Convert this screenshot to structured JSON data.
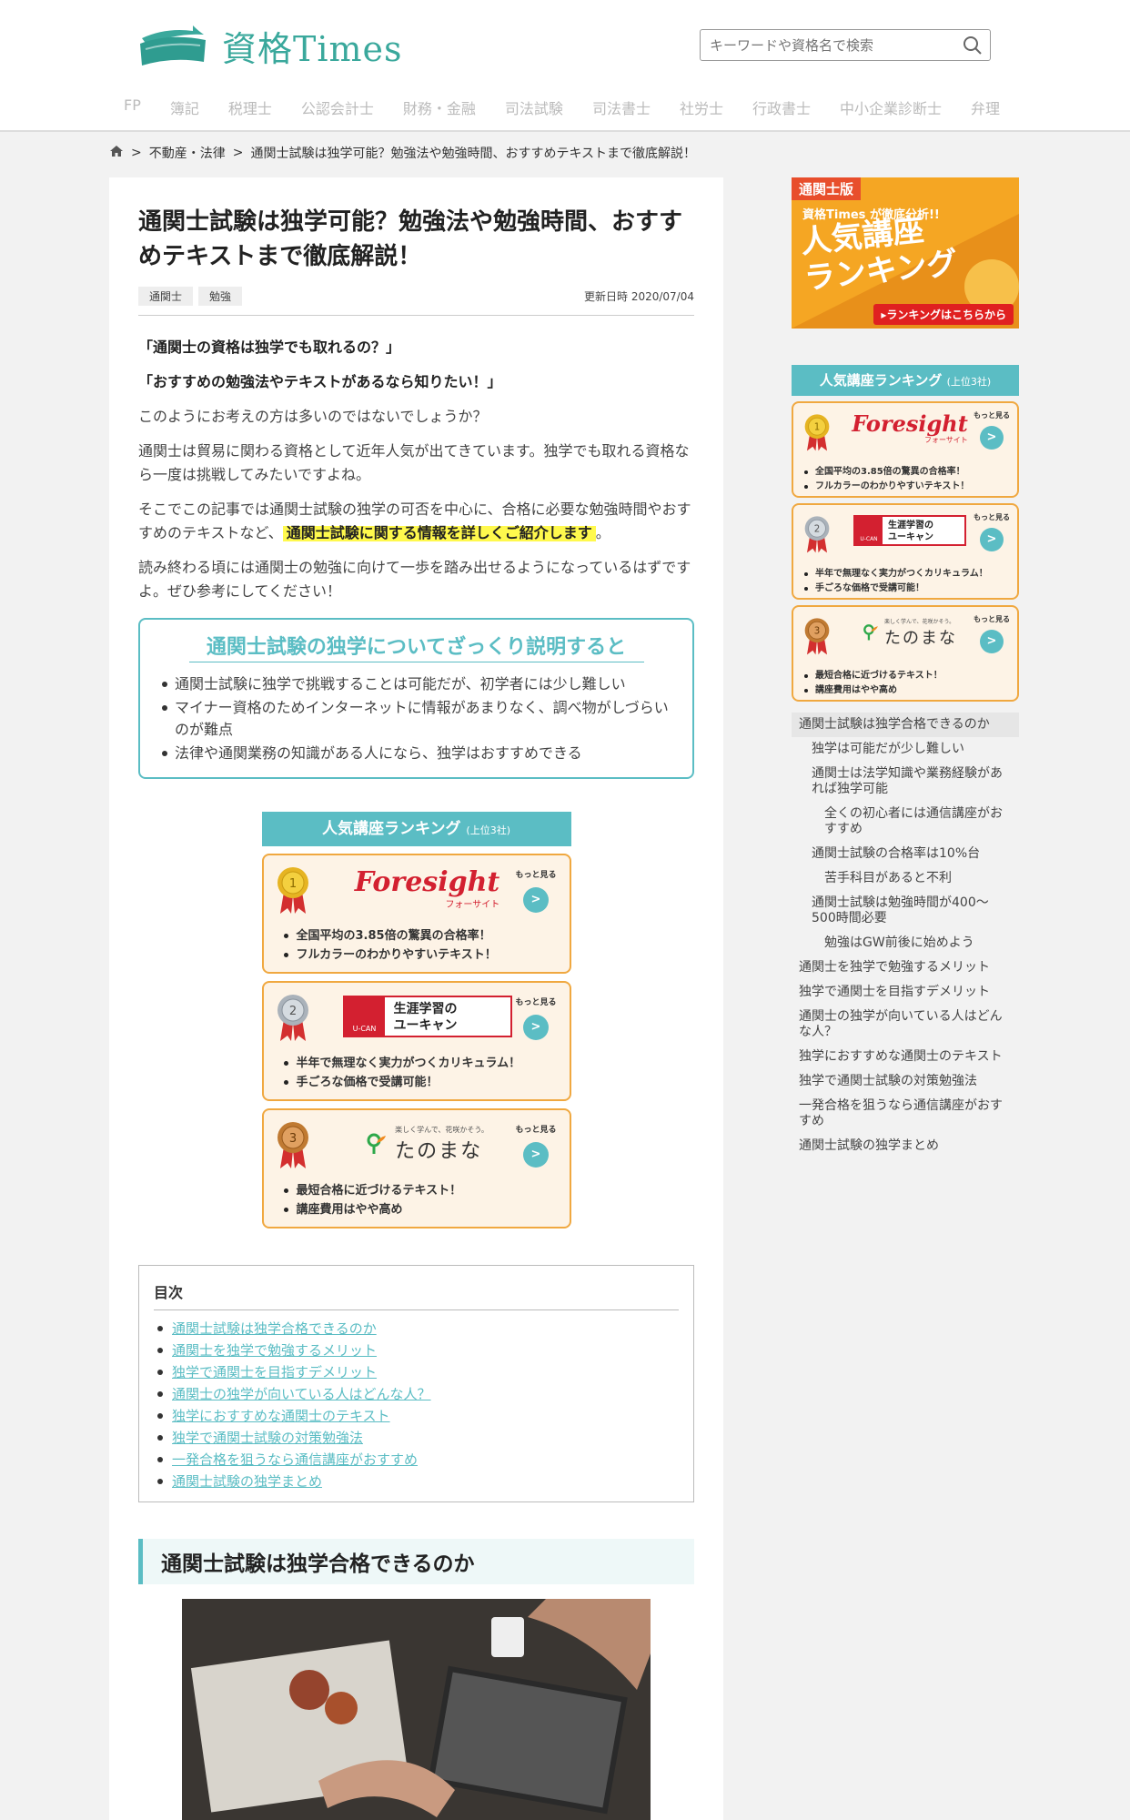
{
  "site": {
    "logo_text": "資格Times"
  },
  "search": {
    "placeholder": "キーワードや資格名で検索"
  },
  "nav": [
    "FP",
    "簿記",
    "税理士",
    "公認会計士",
    "財務・金融",
    "司法試験",
    "司法書士",
    "社労士",
    "行政書士",
    "中小企業診断士",
    "弁理"
  ],
  "breadcrumb": {
    "category": "不動産・法律",
    "current": "通関士試験は独学可能？勉強法や勉強時間、おすすめテキストまで徹底解説！"
  },
  "article": {
    "title": "通関士試験は独学可能？勉強法や勉強時間、おすすめテキストまで徹底解説！",
    "tags": [
      "通関士",
      "勉強"
    ],
    "updated": "更新日時 2020/07/04",
    "intro_q1": "「通関士の資格は独学でも取れるの？」",
    "intro_q2": "「おすすめの勉強法やテキストがあるなら知りたい！」",
    "p1": "このようにお考えの方は多いのではないでしょうか？",
    "p2": "通関士は貿易に関わる資格として近年人気が出てきています。独学でも取れる資格なら一度は挑戦してみたいですよね。",
    "p3_before": "そこでこの記事では通関士試験の独学の可否を中心に、合格に必要な勉強時間やおすすめのテキストなど、",
    "p3_highlight": "通関士試験に関する情報を詳しくご紹介します",
    "p3_after": "。",
    "p4": "読み終わる頃には通関士の勉強に向けて一歩を踏み出せるようになっているはずですよ。ぜひ参考にしてください！",
    "summary_title": "通関士試験の独学についてざっくり説明すると",
    "summary_items": [
      "通関士試験に独学で挑戦することは可能だが、初学者には少し難しい",
      "マイナー資格のためインターネットに情報があまりなく、調べ物がしづらいのが難点",
      "法律や通関業務の知識がある人になら、独学はおすすめできる"
    ],
    "h2": "通関士試験は独学合格できるのか"
  },
  "ranking": {
    "heading": "人気講座ランキング",
    "heading_small": "(上位3社)",
    "more_label": "もっと見る",
    "more_arrow": ">",
    "items": [
      {
        "rank": "1",
        "brand": "Foresight",
        "brand_sub": "フォーサイト",
        "points": [
          "全国平均の3.85倍の驚異の合格率！",
          "フルカラーのわかりやすいテキスト！"
        ]
      },
      {
        "rank": "2",
        "brand": "生涯学習の\nユーキャン",
        "brand_sub": "U-CAN",
        "points": [
          "半年で無理なく実力がつくカリキュラム！",
          "手ごろな価格で受講可能！"
        ]
      },
      {
        "rank": "3",
        "brand": "たのまな",
        "brand_sub": "楽しく学んで、花咲かそう。",
        "points": [
          "最短合格に近づけるテキスト！",
          "講座費用はやや高め"
        ]
      }
    ]
  },
  "toc": {
    "title": "目次",
    "items": [
      "通関士試験は独学合格できるのか",
      "通関士を独学で勉強するメリット",
      "独学で通関士を目指すデメリット",
      "通関士の独学が向いている人はどんな人？",
      "独学におすすめな通関士のテキスト",
      "独学で通関士試験の対策勉強法",
      "一発合格を狙うなら通信講座がおすすめ",
      "通関士試験の独学まとめ"
    ]
  },
  "banner": {
    "label": "通関士版",
    "sub": "資格Times が徹底分析!!",
    "title_line1": "人気講座",
    "title_line2": "ランキング",
    "button": "▸ランキングはこちらから"
  },
  "side_toc": [
    {
      "text": "通関士試験は独学合格できるのか",
      "level": 1,
      "active": true
    },
    {
      "text": "独学は可能だが少し難しい",
      "level": 2
    },
    {
      "text": "通関士は法学知識や業務経験があれば独学可能",
      "level": 2
    },
    {
      "text": "全くの初心者には通信講座がおすすめ",
      "level": 3
    },
    {
      "text": "通関士試験の合格率は10%台",
      "level": 2
    },
    {
      "text": "苦手科目があると不利",
      "level": 3
    },
    {
      "text": "通関士試験は勉強時間が400～500時間必要",
      "level": 2
    },
    {
      "text": "勉強はGW前後に始めよう",
      "level": 3
    },
    {
      "text": "通関士を独学で勉強するメリット",
      "level": 1
    },
    {
      "text": "独学で通関士を目指すデメリット",
      "level": 1
    },
    {
      "text": "通関士の独学が向いている人はどんな人？",
      "level": 1
    },
    {
      "text": "独学におすすめな通関士のテキスト",
      "level": 1
    },
    {
      "text": "独学で通関士試験の対策勉強法",
      "level": 1
    },
    {
      "text": "一発合格を狙うなら通信講座がおすすめ",
      "level": 1
    },
    {
      "text": "通関士試験の独学まとめ",
      "level": 1
    }
  ],
  "colors": {
    "accent": "#5bbdc4",
    "brand": "#3aa89c",
    "rank_border": "#f0a840",
    "highlight": "#fff94d"
  }
}
